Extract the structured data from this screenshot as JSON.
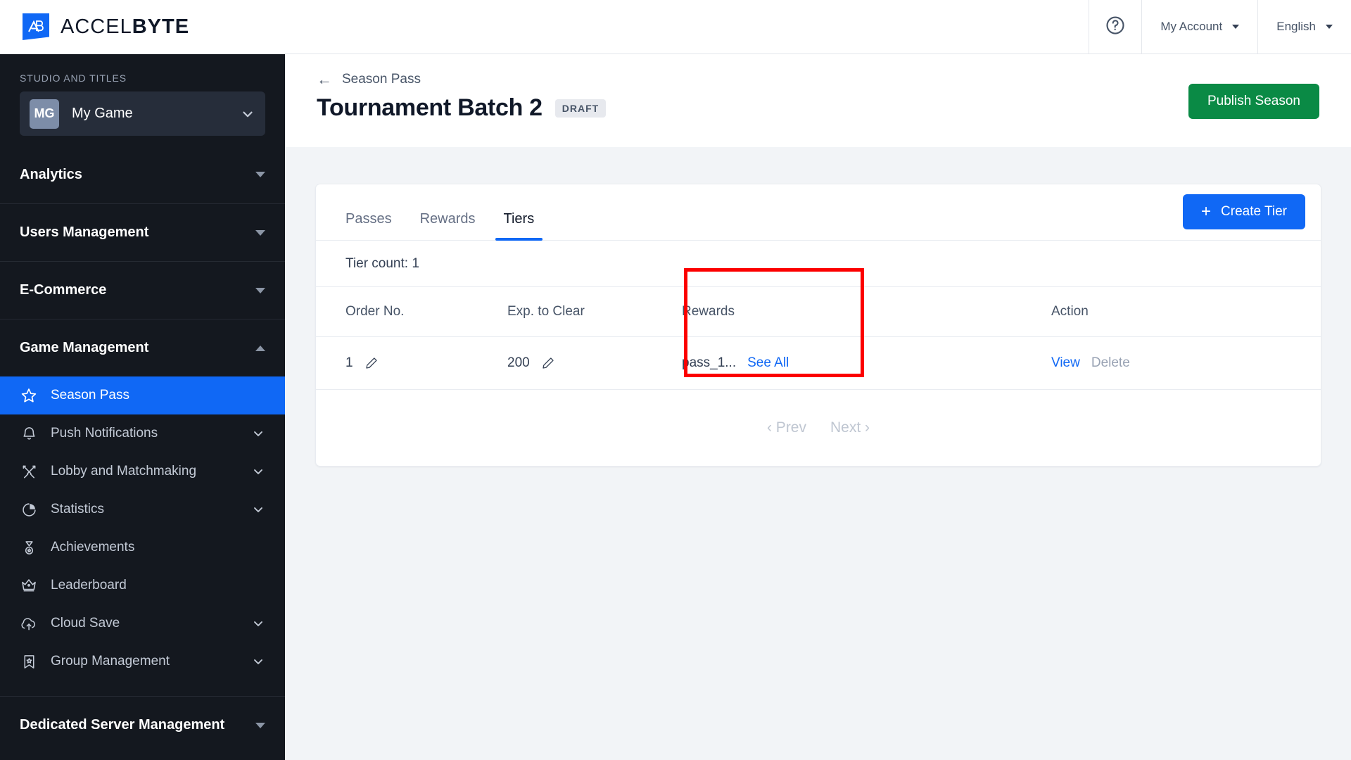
{
  "topbar": {
    "brand_light": "ACCEL",
    "brand_bold": "BYTE",
    "brand_monogram": "AB",
    "help_icon": "question-circle-icon",
    "account_label": "My Account",
    "language_label": "English"
  },
  "sidebar": {
    "studio_label": "STUDIO AND TITLES",
    "game": {
      "initials": "MG",
      "name": "My Game"
    },
    "sections": [
      {
        "label": "Analytics",
        "expanded": false
      },
      {
        "label": "Users Management",
        "expanded": false
      },
      {
        "label": "E-Commerce",
        "expanded": false
      },
      {
        "label": "Game Management",
        "expanded": true
      },
      {
        "label": "Dedicated Server Management",
        "expanded": false
      }
    ],
    "game_management_items": [
      {
        "label": "Season Pass",
        "icon": "star-icon",
        "active": true,
        "has_chevron": false
      },
      {
        "label": "Push Notifications",
        "icon": "bell-icon",
        "active": false,
        "has_chevron": true
      },
      {
        "label": "Lobby and Matchmaking",
        "icon": "crossed-swords-icon",
        "active": false,
        "has_chevron": true
      },
      {
        "label": "Statistics",
        "icon": "pie-chart-icon",
        "active": false,
        "has_chevron": true
      },
      {
        "label": "Achievements",
        "icon": "medal-icon",
        "active": false,
        "has_chevron": false
      },
      {
        "label": "Leaderboard",
        "icon": "crown-icon",
        "active": false,
        "has_chevron": false
      },
      {
        "label": "Cloud Save",
        "icon": "cloud-upload-icon",
        "active": false,
        "has_chevron": true
      },
      {
        "label": "Group Management",
        "icon": "banner-star-icon",
        "active": false,
        "has_chevron": true
      }
    ]
  },
  "page": {
    "breadcrumb": "Season Pass",
    "back_icon": "arrow-left-icon",
    "title": "Tournament Batch 2",
    "status_badge": "DRAFT",
    "publish_label": "Publish Season"
  },
  "card": {
    "tabs": [
      {
        "label": "Passes",
        "active": false
      },
      {
        "label": "Rewards",
        "active": false
      },
      {
        "label": "Tiers",
        "active": true
      }
    ],
    "create_label": "Create Tier",
    "create_icon": "plus-icon",
    "tier_count": "Tier count: 1",
    "table": {
      "columns": [
        "Order No.",
        "Exp. to Clear",
        "Rewards",
        "Action"
      ],
      "rows": [
        {
          "order_no": "1",
          "order_edit_icon": "pencil-icon",
          "exp_to_clear": "200",
          "exp_edit_icon": "pencil-icon",
          "rewards_text": "pass_1...",
          "rewards_link": "See All",
          "action_view": "View",
          "action_delete": "Delete"
        }
      ]
    },
    "pagination": {
      "prev": "‹ Prev",
      "next": "Next ›"
    }
  },
  "colors": {
    "accent_blue": "#1068f5",
    "publish_green": "#0a8a45",
    "sidebar_bg": "#14181f",
    "content_bg": "#f2f4f7",
    "annotation_red": "#fc0000"
  },
  "annotation": {
    "name": "rewards-column-highlight"
  }
}
